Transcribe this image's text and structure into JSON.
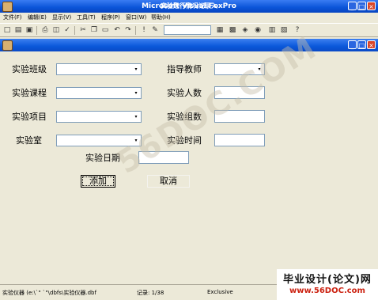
{
  "app": {
    "title": "Microsoft Visual FoxPro",
    "minimize": "_",
    "maximize": "□",
    "close": "×"
  },
  "menu": [
    "文件(F)",
    "编辑(E)",
    "显示(V)",
    "工具(T)",
    "程序(P)",
    "窗口(W)",
    "帮助(H)"
  ],
  "form": {
    "title": "实验进行情况记录入",
    "labels": {
      "class": "实验班级",
      "course": "实验课程",
      "project": "实验项目",
      "room": "实验室",
      "teacher": "指导教师",
      "people": "实验人数",
      "groups": "实验组数",
      "time": "实验时间",
      "date": "实验日期"
    },
    "add_button": "添加",
    "cancel_button": "取消",
    "combo_arrow": "▾"
  },
  "watermark": "56DOC.COM",
  "statusbar": {
    "table": "实验仪器 (e:\\`\"  `\"\\dbfs\\实验仪器.dbf",
    "record": "记录: 1/38",
    "mode": "Exclusive"
  },
  "brand": {
    "line1": "毕业设计(论文)网",
    "line2": "www.56DOC.com"
  },
  "colors": {
    "titlebar": "#0a54d8",
    "face": "#ece9d8",
    "close_button": "#d8462a"
  }
}
